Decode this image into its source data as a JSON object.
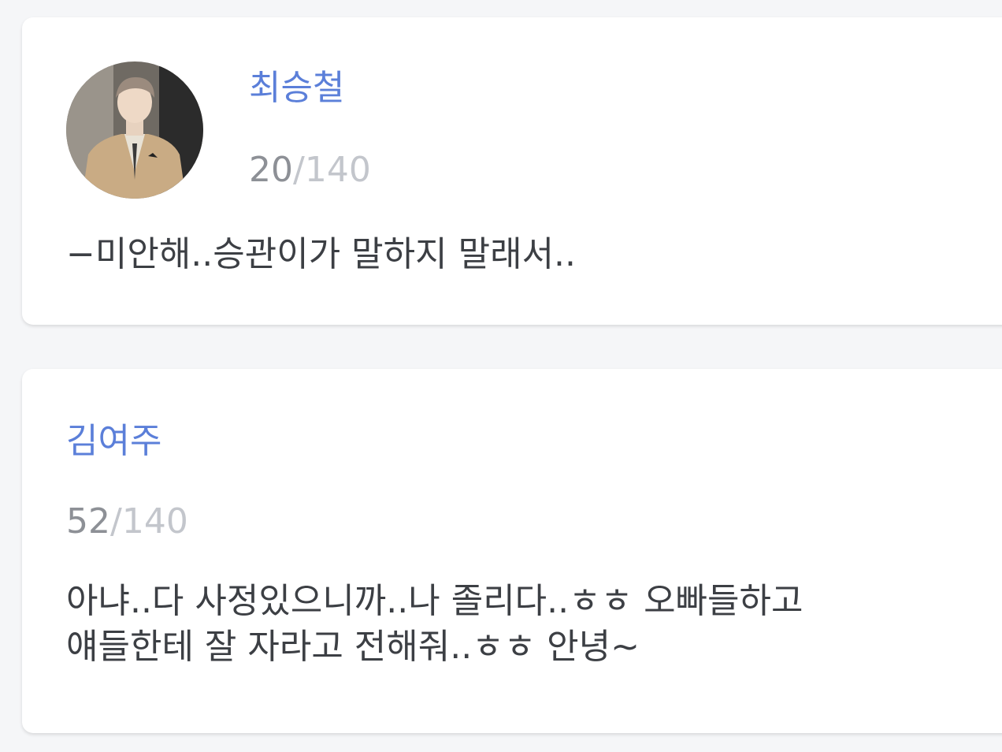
{
  "messages": [
    {
      "name": "최승철",
      "count": "20",
      "separator": "/",
      "max": "140",
      "lines": [
        "−미안해..승관이가 말하지 말래서.."
      ]
    },
    {
      "name": "김여주",
      "count": "52",
      "separator": "/",
      "max": "140",
      "lines": [
        "아냐..다 사정있으니까..나 졸리다..ㅎㅎ 오빠들하고",
        "얘들한테 잘 자라고 전해줘..ㅎㅎ 안녕~"
      ]
    }
  ],
  "colors": {
    "name": "#5b7fd9",
    "count_current": "#8d9096",
    "count_max": "#c3c6cc",
    "message_text": "#3c3f44",
    "page_background": "#f5f6f8",
    "card_background": "#ffffff"
  }
}
